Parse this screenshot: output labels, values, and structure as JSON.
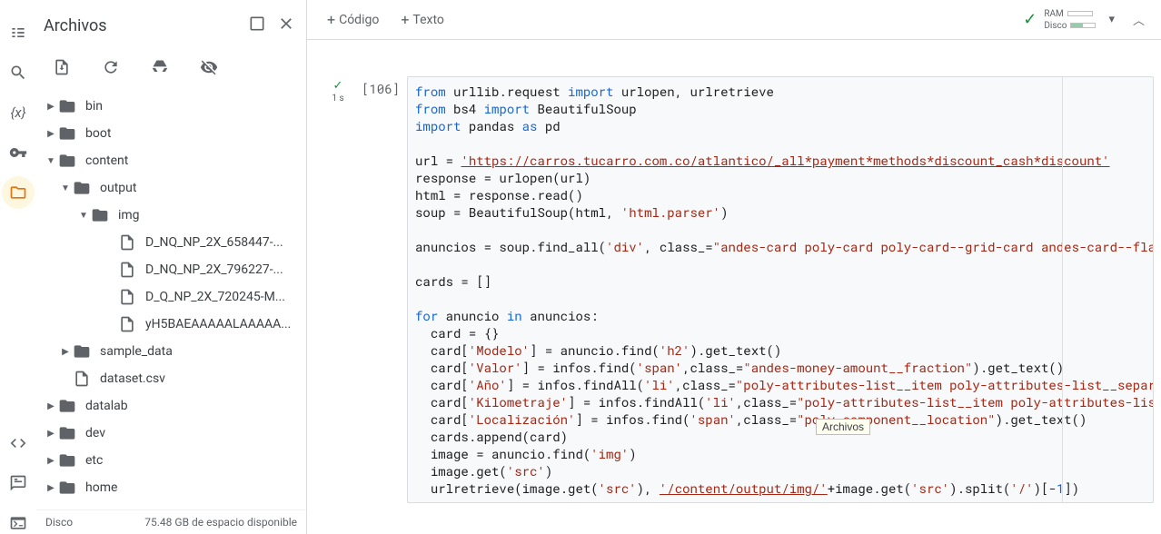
{
  "panel": {
    "title": "Archivos",
    "footer_left": "Disco",
    "footer_right": "75.48 GB de espacio disponible"
  },
  "tree": {
    "bin": "bin",
    "boot": "boot",
    "content": "content",
    "output": "output",
    "img": "img",
    "files": [
      "D_NQ_NP_2X_658447-...",
      "D_NQ_NP_2X_796227-...",
      "D_Q_NP_2X_720245-M...",
      "yH5BAEAAAAALAAAAA..."
    ],
    "sample_data": "sample_data",
    "dataset": "dataset.csv",
    "datalab": "datalab",
    "dev": "dev",
    "etc": "etc",
    "home": "home"
  },
  "toolbar": {
    "code_label": "Código",
    "text_label": "Texto",
    "ram_label": "RAM",
    "disk_label": "Disco"
  },
  "cell": {
    "exec_id": "[106]",
    "time": "1 s"
  },
  "code": {
    "l1_a": "from",
    "l1_b": " urllib.request ",
    "l1_c": "import",
    "l1_d": " urlopen, urlretrieve",
    "l2_a": "from",
    "l2_b": " bs4 ",
    "l2_c": "import",
    "l2_d": " BeautifulSoup",
    "l3_a": "import",
    "l3_b": " pandas ",
    "l3_c": "as",
    "l3_d": " pd",
    "l5_a": "url = ",
    "l5_b": "'https://carros.tucarro.com.co/atlantico/_all*payment*methods*discount_cash*discount'",
    "l6_a": "response = urlopen(url)",
    "l7_a": "html = response.read()",
    "l8_a": "soup = BeautifulSoup(html, ",
    "l8_b": "'html.parser'",
    "l8_c": ")",
    "l10_a": "anuncios = soup.find_all(",
    "l10_b": "'div'",
    "l10_c": ", class_=",
    "l10_d": "\"andes-card poly-card poly-card--grid-card andes-card--flat an",
    "l12_a": "cards = []",
    "l14_a": "for",
    "l14_b": " anuncio ",
    "l14_c": "in",
    "l14_d": " anuncios:",
    "l15_a": "  card = {}",
    "l16_a": "  card[",
    "l16_b": "'Modelo'",
    "l16_c": "] = anuncio.find(",
    "l16_d": "'h2'",
    "l16_e": ").get_text()",
    "l17_a": "  card[",
    "l17_b": "'Valor'",
    "l17_c": "] = infos.find(",
    "l17_d": "'span'",
    "l17_e": ",class_=",
    "l17_f": "\"andes-money-amount__fraction\"",
    "l17_g": ").get_text()",
    "l18_a": "  card[",
    "l18_b": "'Año'",
    "l18_c": "] = infos.findAll(",
    "l18_d": "'li'",
    "l18_e": ",class_=",
    "l18_f": "\"poly-attributes-list__item poly-attributes-list__separato",
    "l19_a": "  card[",
    "l19_b": "'Kilometraje'",
    "l19_c": "] = infos.findAll(",
    "l19_d": "'li'",
    "l19_e": ",class_=",
    "l19_f": "\"poly-attributes-list__item poly-attributes-list__s",
    "l20_a": "  card[",
    "l20_b": "'Localización'",
    "l20_c": "] = infos.find(",
    "l20_d": "'span'",
    "l20_e": ",class_=",
    "l20_f": "\"poly-component__location\"",
    "l20_g": ").get_text()",
    "l21_a": "  cards.append(card)",
    "l22_a": "  image = anuncio.find(",
    "l22_b": "'img'",
    "l22_c": ")",
    "l23_a": "  image.get(",
    "l23_b": "'src'",
    "l23_c": ")",
    "l24_a": "  urlretrieve(image.get(",
    "l24_b": "'src'",
    "l24_c": "), ",
    "l24_d": "'/content/output/img/'",
    "l24_e": "+image.get(",
    "l24_f": "'src'",
    "l24_g": ").split(",
    "l24_h": "'/'",
    "l24_i": ")[-",
    "l24_j": "1",
    "l24_k": "])"
  },
  "tooltip": "Archivos"
}
